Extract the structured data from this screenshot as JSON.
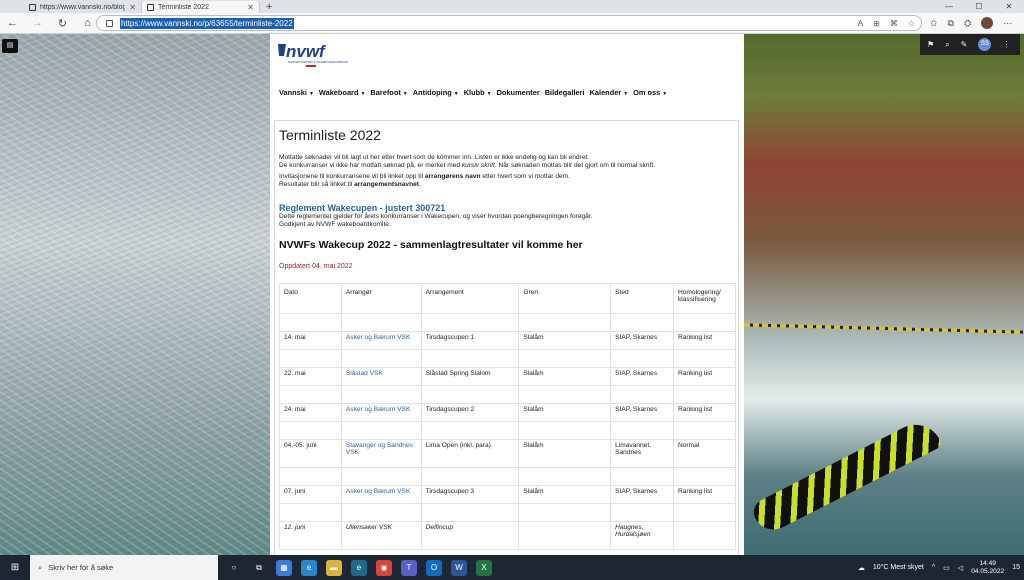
{
  "browser": {
    "tabs": [
      {
        "title": "https://www.vannski.no/blog/ne"
      },
      {
        "title": "Terminliste 2022"
      }
    ],
    "new_tab": "+",
    "window_controls": [
      "—",
      "☐",
      "✕"
    ],
    "url": "https://www.vannski.no/p/63655/terminliste-2022"
  },
  "site": {
    "logo_text": "nvwf",
    "logo_subtitle": "NORGES VANNSKI & WAKEBOARDFORBUND",
    "menu": [
      {
        "label": "Vannski",
        "dropdown": true
      },
      {
        "label": "Wakeboard",
        "dropdown": true
      },
      {
        "label": "Barefoot",
        "dropdown": true
      },
      {
        "label": "Antidoping",
        "dropdown": true
      },
      {
        "label": "Klubb",
        "dropdown": true
      },
      {
        "label": "Dokumenter",
        "dropdown": false
      },
      {
        "label": "Bildegalleri",
        "dropdown": false
      },
      {
        "label": "Kalender",
        "dropdown": true
      },
      {
        "label": "Om oss",
        "dropdown": true
      }
    ],
    "admin_avatar": "SS"
  },
  "article": {
    "title": "Terminliste 2022",
    "intro_line1": "Mottatte søknader vil bli lagt ut her etter hvert som de kommer inn. Listen er ikke endelig og kan bli endret.",
    "intro_line2a": "De konkurranser vi ikke har mottatt søknad på, er merket med ",
    "intro_line2_italic": "kursiv skrift",
    "intro_line2b": ".  Når søknaden mottas blir det gjort om til normal skrift.",
    "invite_line1a": "Invitasjonene til konkurransene vil bli linket opp til ",
    "invite_line1_bold": "arrangørens navn",
    "invite_line1b": " etter hvert som vi mottar dem.",
    "invite_line2a": "Resultater blir så linket til ",
    "invite_line2_bold": "arrangementsnavnet",
    "invite_line2b": ".",
    "rules_link": "Reglement Wakecupen - justert 300721",
    "rules_line1": "Dette reglementet gjelder for årets konkurranser i Wakecupen, og viser hvordan poengberegningen foregår.",
    "rules_line2": "Godkjent av NVWF wakeboardkomite.",
    "section_title": "NVWFs Wakecup 2022 - sammenlagtresultater vil komme her",
    "updated": "Oppdatert 04. mai 2022"
  },
  "table": {
    "headers": [
      "Dato",
      "Arrangør",
      "Arrangement",
      "Gren",
      "Sted",
      "Homologering/ klassifisering"
    ],
    "rows": [
      {
        "date": "14. mai",
        "organizer": "Asker og Bærum VSK",
        "event": "Tirsdagscupen 1",
        "discipline": "Slalåm",
        "place": "SIAP, Skarnes",
        "class": "Ranking list"
      },
      {
        "date": "22. mai",
        "organizer": "Slåstad VSK",
        "event": "Slåstad Spring Slalom",
        "discipline": "Slalåm",
        "place": "SIAP, Skarnes",
        "class": "Ranking list"
      },
      {
        "date": "24. mai",
        "organizer": "Asker og Bærum VSK",
        "event": "Tirsdagscupen 2",
        "discipline": "Slalåm",
        "place": "SIAP, Skarnes",
        "class": "Ranking list"
      },
      {
        "date": "04.-05. juni",
        "organizer": "Stavanger og Sandnes VSK",
        "event": "Lima Open (inkl. para).",
        "discipline": "Slalåm",
        "place": "Limavannet, Sandnes",
        "class": "Normal"
      },
      {
        "date": "07. juni",
        "organizer": "Asker og Bærum VSK",
        "event": "Tirsdagscupen 3",
        "discipline": "Slalåm",
        "place": "SIAP, Skarnes",
        "class": "Ranking list"
      },
      {
        "date": "12. juni",
        "organizer": "Ullensaker VSK",
        "event": "Delfincup",
        "discipline": "",
        "place": "Haugnes, Hurdalsjøen",
        "class": ""
      }
    ]
  },
  "taskbar": {
    "search_placeholder": "Skriv her for å søke",
    "weather": "10°C  Mest skyet",
    "time": "14:49",
    "date": "04.05.2022",
    "notification_count": "15"
  }
}
